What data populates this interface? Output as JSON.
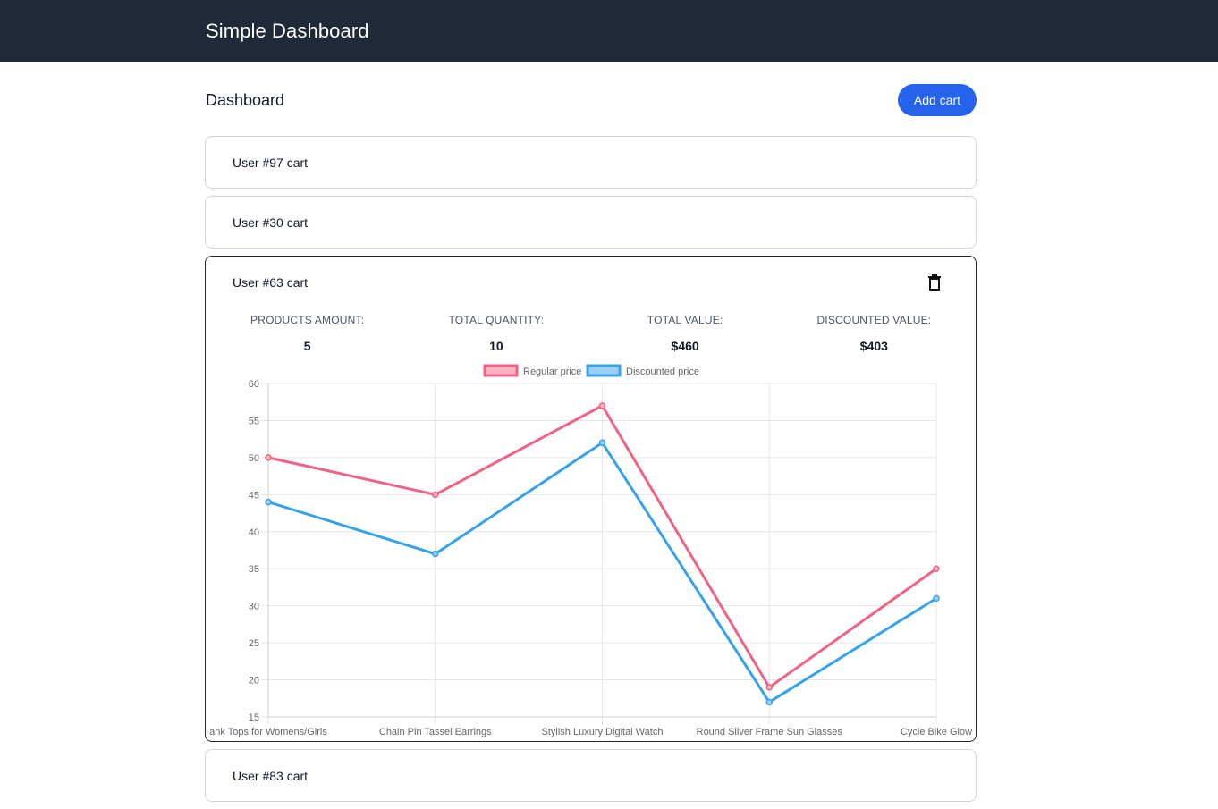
{
  "app": {
    "title": "Simple Dashboard"
  },
  "page": {
    "title": "Dashboard",
    "add_button": "Add cart"
  },
  "carts": [
    {
      "title": "User #97 cart",
      "expanded": false
    },
    {
      "title": "User #30 cart",
      "expanded": false
    },
    {
      "title": "User #63 cart",
      "expanded": true
    },
    {
      "title": "User #83 cart",
      "expanded": false
    }
  ],
  "expanded_cart": {
    "icon": "trash-icon",
    "stats": [
      {
        "label": "PRODUCTS AMOUNT:",
        "value": "5"
      },
      {
        "label": "TOTAL QUANTITY:",
        "value": "10"
      },
      {
        "label": "TOTAL VALUE:",
        "value": "$460"
      },
      {
        "label": "DISCOUNTED VALUE:",
        "value": "$403"
      }
    ]
  },
  "chart_data": {
    "type": "line",
    "categories": [
      "ank Tops for Womens/Girls",
      "Chain Pin Tassel Earrings",
      "Stylish Luxury Digital Watch",
      "Round Silver Frame Sun Glasses",
      "Cycle Bike Glow"
    ],
    "series": [
      {
        "name": "Regular price",
        "values": [
          50,
          45,
          57,
          19,
          35
        ],
        "color": "#f06384",
        "fill": "#ffb1c1"
      },
      {
        "name": "Discounted price",
        "values": [
          44,
          37,
          52,
          17,
          31
        ],
        "color": "#36a2eb",
        "fill": "#9ad0f5"
      }
    ],
    "ylim": [
      15,
      60
    ],
    "yticks": [
      60,
      55,
      50,
      45,
      40,
      35,
      30,
      25,
      20,
      15
    ],
    "legend": "top-center",
    "grid": true
  }
}
